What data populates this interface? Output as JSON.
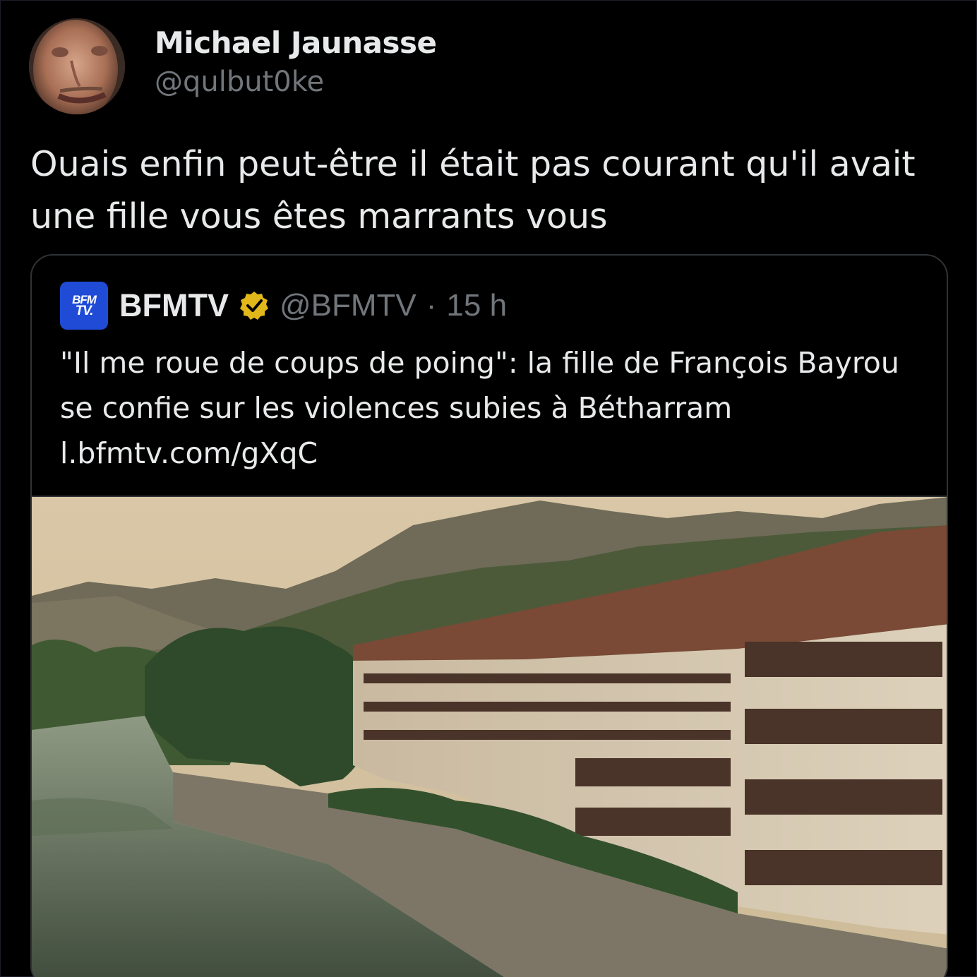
{
  "author": {
    "name": "Michael Jaunasse",
    "handle": "@qulbut0ke"
  },
  "tweet": {
    "text": "Ouais enfin peut-être il était pas courant qu'il avait une fille vous êtes marrants vous"
  },
  "quoted_tweet": {
    "account_name": "BFMTV",
    "logo_text_line1": "BFM",
    "logo_text_line2": "TV.",
    "handle": "@BFMTV",
    "separator": "·",
    "time": "15 h",
    "text": "\"Il me roue de coups de poing\": la fille de François Bayrou se confie sur les violences subies à Bétharram",
    "link": "l.bfmtv.com/gXqC",
    "verified_badge_color": "#e2b719",
    "logo_color": "#1f4bd6"
  },
  "colors": {
    "background": "#000000",
    "text_primary": "#e7e9ea",
    "text_secondary": "#71767b",
    "card_border": "#2f3336"
  }
}
